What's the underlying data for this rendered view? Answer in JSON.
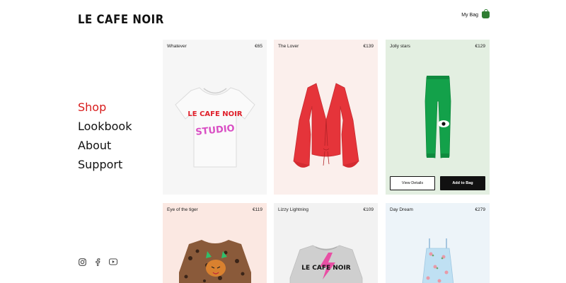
{
  "brand": {
    "logo_text": "LE CAFE NOIR"
  },
  "header": {
    "bag_label": "My Bag"
  },
  "nav": {
    "items": [
      "Shop",
      "Lookbook",
      "About",
      "Support"
    ],
    "active": "Shop"
  },
  "products": [
    {
      "name": "Whatever",
      "price": "€65",
      "bg": "#f6f6f6",
      "print_line1": "LE CAFE NOIR",
      "print_line2": "STUDIO"
    },
    {
      "name": "The Lover",
      "price": "€139",
      "bg": "#fbefec"
    },
    {
      "name": "Jolly stars",
      "price": "€129",
      "bg": "#e3efe1",
      "view_label": "View Details",
      "add_label": "Add to Bag"
    },
    {
      "name": "Eye of the tiger",
      "price": "€119",
      "bg": "#fbe8e2"
    },
    {
      "name": "Lizzy Lightning",
      "price": "€109",
      "bg": "#f2f2f2",
      "print_line1": "LE CAFE NOIR"
    },
    {
      "name": "Day Dream",
      "price": "€279",
      "bg": "#edf4f9"
    }
  ],
  "colors": {
    "accent": "#d81b1b",
    "bag_icon": "#2f7d32"
  },
  "icons": [
    "instagram-icon",
    "facebook-icon",
    "youtube-icon",
    "bag-icon"
  ]
}
